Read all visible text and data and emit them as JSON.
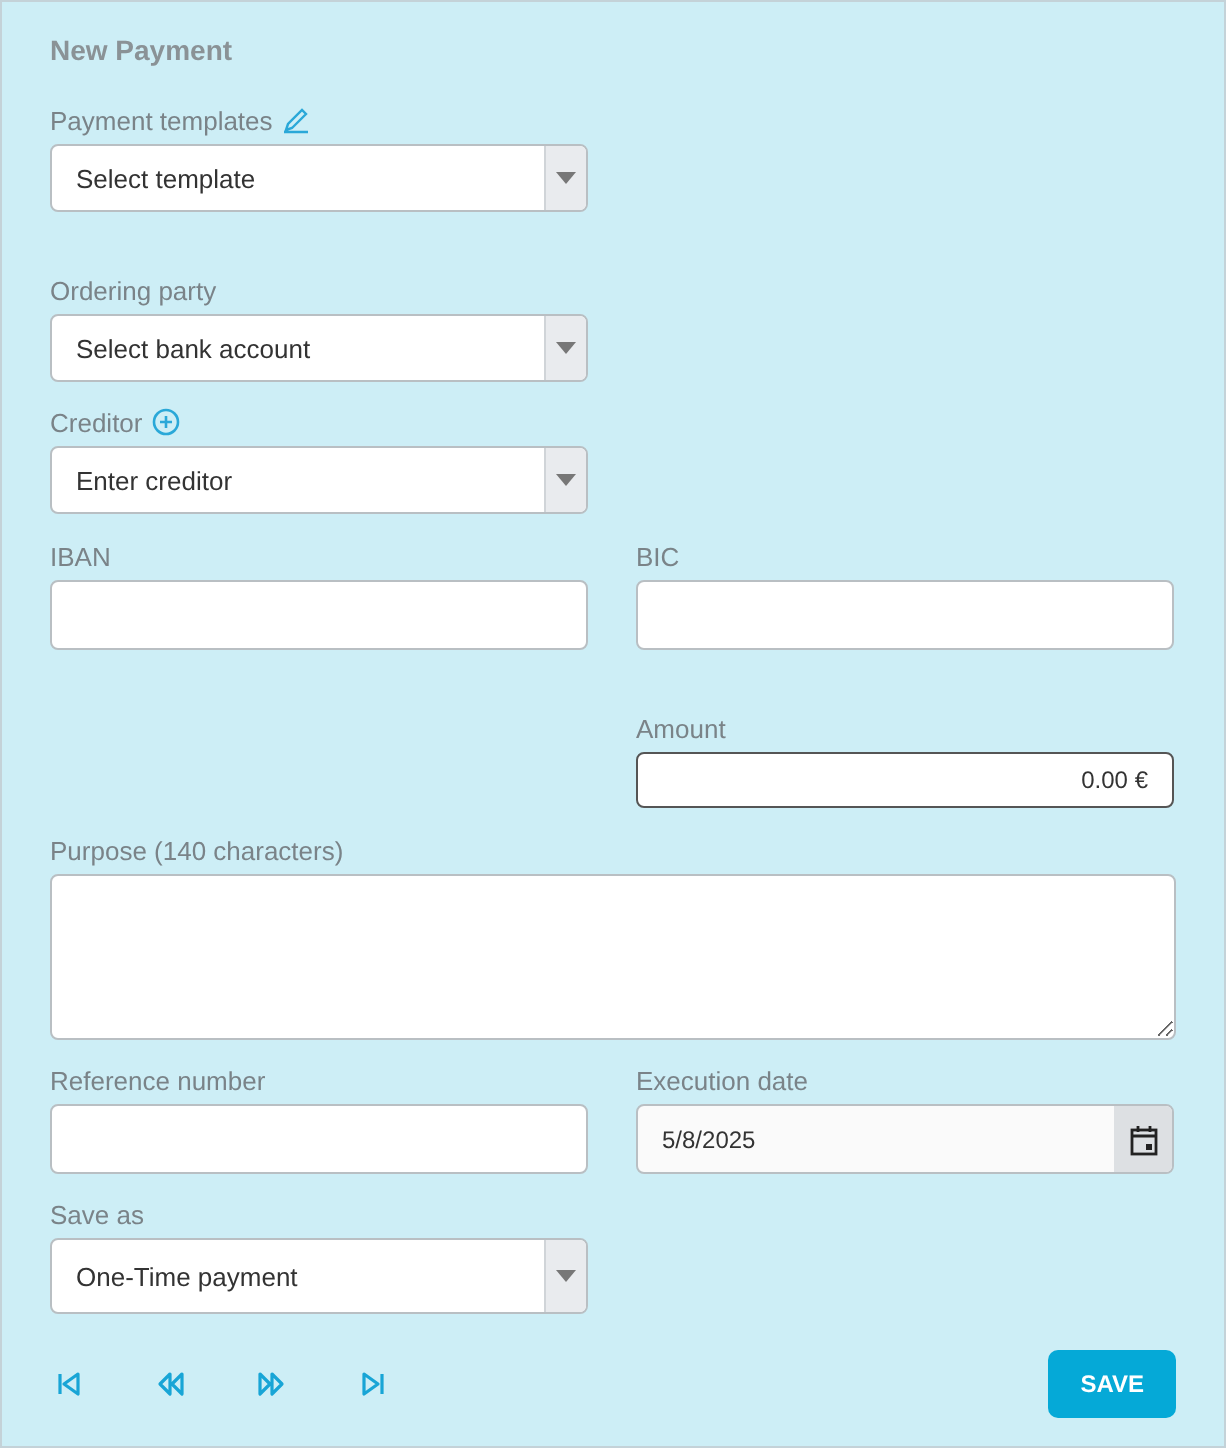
{
  "title": "New Payment",
  "template": {
    "label": "Payment templates",
    "value": "Select template"
  },
  "ordering_party": {
    "label": "Ordering party",
    "value": "Select bank account"
  },
  "creditor": {
    "label": "Creditor",
    "value": "Enter creditor"
  },
  "iban": {
    "label": "IBAN"
  },
  "bic": {
    "label": "BIC"
  },
  "amount": {
    "label": "Amount",
    "value": "0.00 €"
  },
  "purpose": {
    "label": "Purpose (140 characters)"
  },
  "reference": {
    "label": "Reference number"
  },
  "execution_date": {
    "label": "Execution date",
    "value": "5/8/2025"
  },
  "save_as": {
    "label": "Save as",
    "value": "One-Time payment"
  },
  "nav_buttons": [
    {
      "kind": "first"
    },
    {
      "kind": "previous"
    },
    {
      "kind": "next"
    },
    {
      "kind": "last"
    }
  ],
  "save_button": "SAVE"
}
